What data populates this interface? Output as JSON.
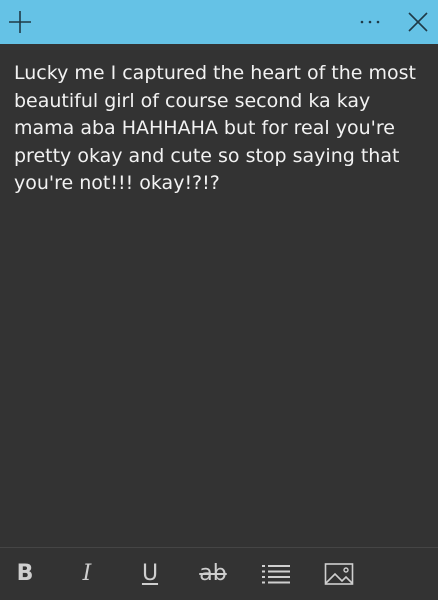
{
  "titlebar": {
    "color": "#65c2e6",
    "add_icon": "plus-icon",
    "menu_icon": "more-dots-icon",
    "close_icon": "close-icon"
  },
  "note": {
    "text": "Lucky me I captured the heart of the most beautiful girl of course second ka kay mama aba HAHHAHA but for real you're pretty okay and cute so stop saying that you're not!!! okay!?!?"
  },
  "toolbar": {
    "bold_label": "B",
    "italic_label": "I",
    "underline_label": "U",
    "strikethrough_label": "ab",
    "list_icon": "bulleted-list-icon",
    "image_icon": "insert-image-icon"
  }
}
